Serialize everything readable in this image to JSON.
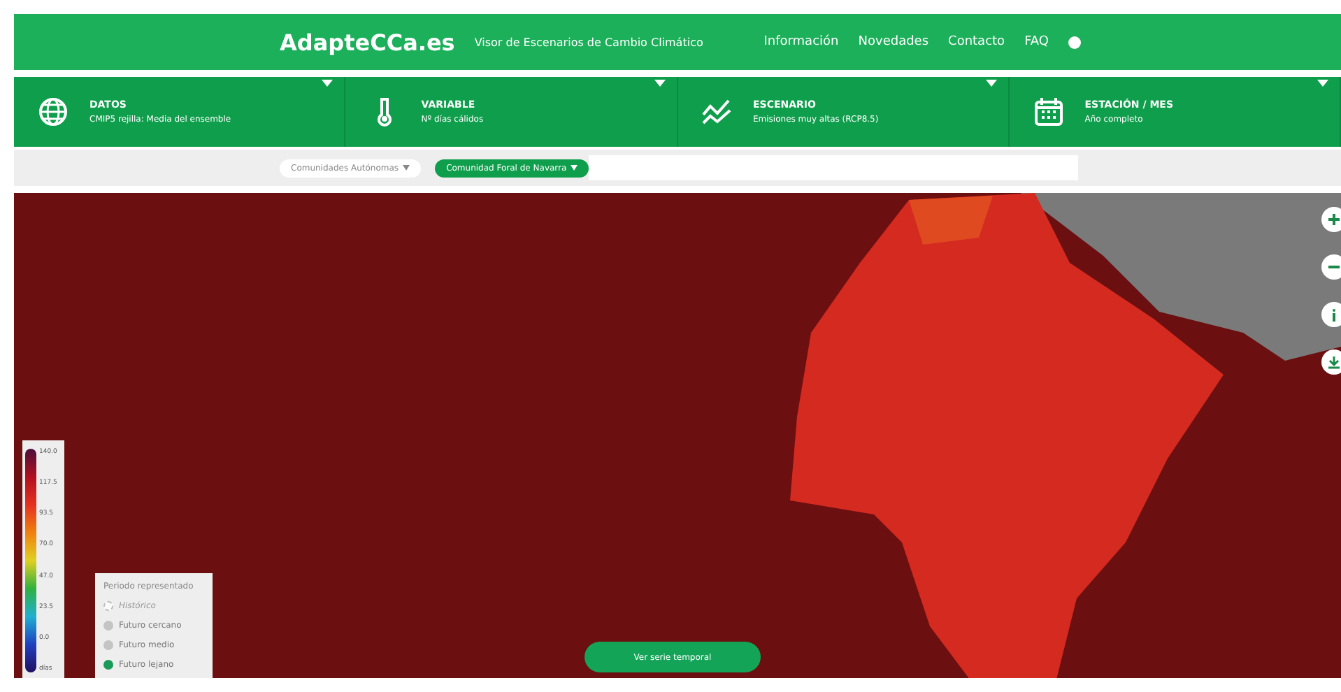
{
  "header": {
    "logo": "AdapteCCa.es",
    "subtitle": "Visor de Escenarios de Cambio Climático",
    "nav": [
      "Información",
      "Novedades",
      "Contacto",
      "FAQ"
    ]
  },
  "selectors": [
    {
      "kind": "globe",
      "label": "DATOS",
      "value": "CMIP5 rejilla: Media del ensemble"
    },
    {
      "kind": "thermometer",
      "label": "VARIABLE",
      "value": "Nº días cálidos"
    },
    {
      "kind": "trend",
      "label": "ESCENARIO",
      "value": "Emisiones muy altas (RCP8.5)"
    },
    {
      "kind": "calendar",
      "label": "ESTACIÓN / MES",
      "value": "Año completo"
    }
  ],
  "filters": {
    "region_type": "Comunidades Autónomas",
    "region": "Comunidad Foral de Navarra"
  },
  "legend": {
    "unit": "días",
    "values": [
      "140.0",
      "117.5",
      "93.5",
      "70.0",
      "47.0",
      "23.5",
      "0.0"
    ]
  },
  "periods": {
    "title": "Periodo representado",
    "items": [
      {
        "label": "Histórico",
        "selected": false,
        "disabled": true
      },
      {
        "label": "Futuro cercano",
        "selected": false,
        "disabled": false
      },
      {
        "label": "Futuro medio",
        "selected": false,
        "disabled": false
      },
      {
        "label": "Futuro lejano",
        "selected": true,
        "disabled": false
      }
    ]
  },
  "action_button": "Ver serie temporal"
}
